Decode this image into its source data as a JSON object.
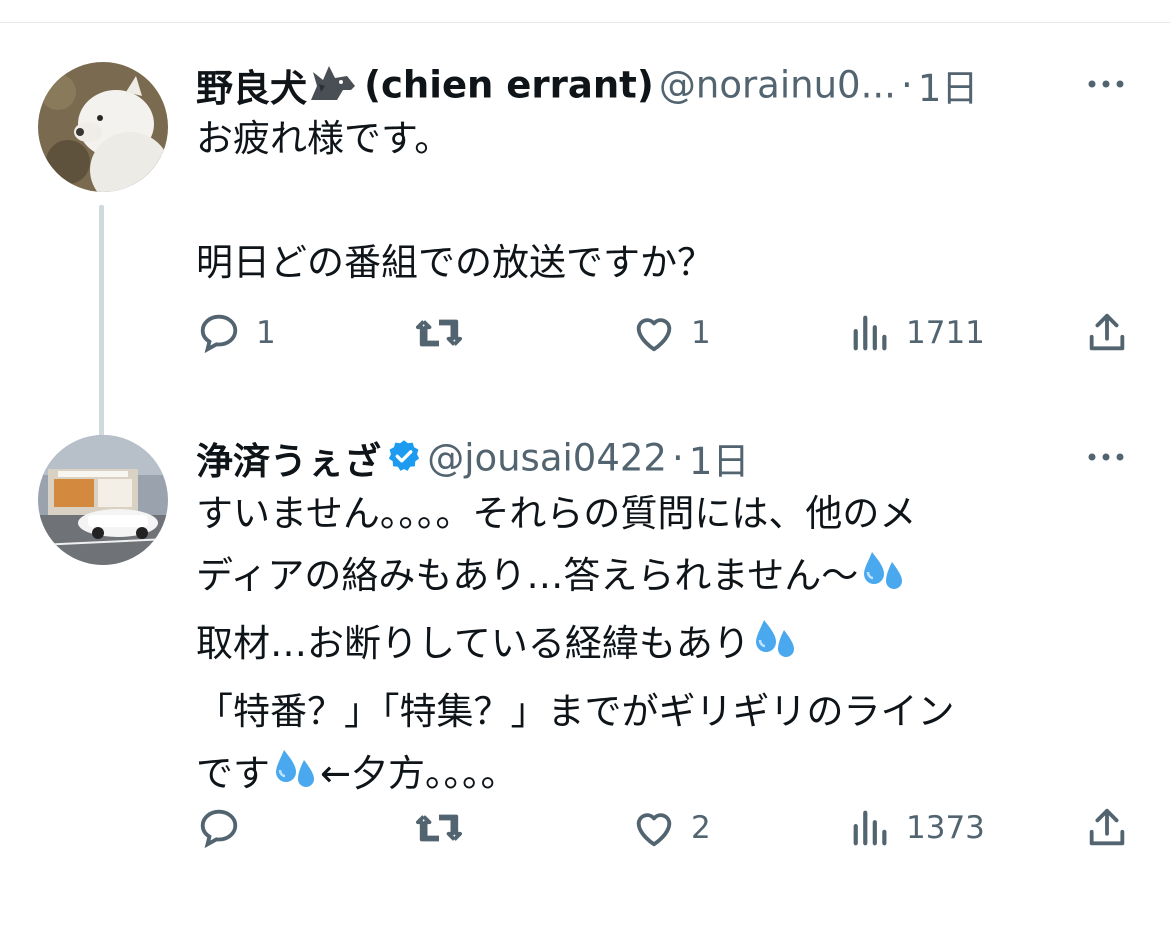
{
  "tweets": [
    {
      "display_name": "野良犬",
      "name_suffix": "(chien errant)",
      "handle": "@norainu0...",
      "dot": "·",
      "time": "1日",
      "text": "お疲れ様です。\n\n明日どの番組での放送ですか？",
      "actions": {
        "replies": "1",
        "retweets": "",
        "likes": "1",
        "views": "1711"
      }
    },
    {
      "display_name": "浄済うぇざ",
      "handle": "@jousai0422",
      "dot": "·",
      "time": "1日",
      "text_lines": [
        "すいません。。。。それらの質問には、他のメ",
        "ディアの絡みもあり…答えられません〜",
        "取材…お断りしている経緯もあり",
        "「特番？」「特集？」までがギリギリのライン",
        "です",
        "←夕方。。。。"
      ],
      "actions": {
        "replies": "",
        "retweets": "",
        "likes": "2",
        "views": "1373"
      }
    }
  ],
  "icons": {
    "more": "more-icon",
    "reply": "reply-icon",
    "retweet": "retweet-icon",
    "like": "heart-icon",
    "views": "views-icon",
    "share": "share-icon",
    "verified": "verified-badge-icon",
    "wolf": "wolf-emoji-icon",
    "sweat": "sweat-droplets-emoji-icon"
  },
  "colors": {
    "icon_gray": "#536471",
    "verified_blue": "#1d9bf0",
    "text": "#0f1419"
  }
}
